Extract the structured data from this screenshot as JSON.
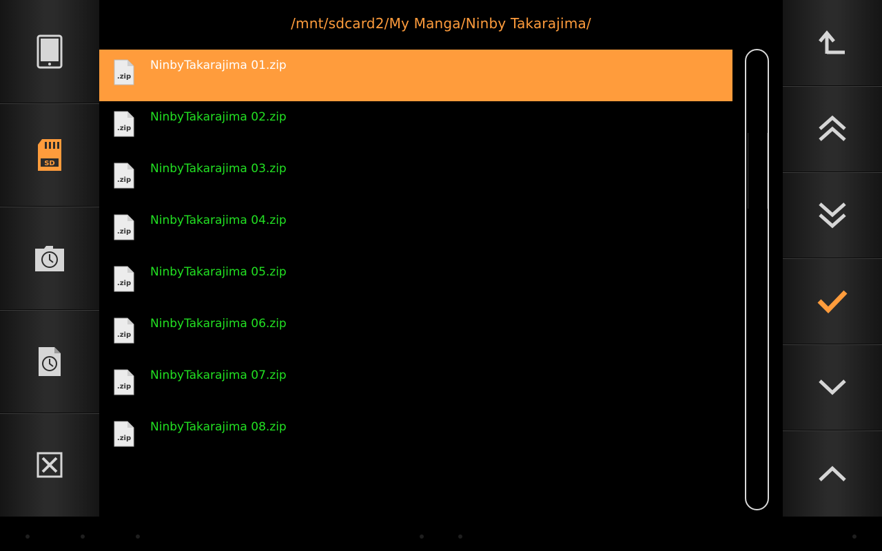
{
  "path": "/mnt/sdcard2/My Manga/Ninby Takarajima/",
  "colors": {
    "accent": "#ff9c3c",
    "file_text": "#22e022",
    "selected_text": "#ffffff",
    "icon_gray": "#d6d6d6"
  },
  "left_toolbar": [
    {
      "name": "tablet-storage-button",
      "icon": "tablet-icon"
    },
    {
      "name": "sd-card-button",
      "icon": "sd-card-icon",
      "active": true
    },
    {
      "name": "recent-folder-button",
      "icon": "folder-clock-icon"
    },
    {
      "name": "recent-file-button",
      "icon": "file-clock-icon"
    },
    {
      "name": "close-button",
      "icon": "close-box-icon"
    }
  ],
  "right_toolbar": [
    {
      "name": "parent-folder-button",
      "icon": "up-arrow-icon"
    },
    {
      "name": "page-up-button",
      "icon": "double-chevron-up-icon"
    },
    {
      "name": "page-down-button",
      "icon": "double-chevron-down-icon"
    },
    {
      "name": "confirm-button",
      "icon": "checkmark-icon",
      "active": true
    },
    {
      "name": "scroll-down-button",
      "icon": "chevron-down-icon"
    },
    {
      "name": "scroll-up-button",
      "icon": "chevron-up-icon"
    }
  ],
  "files": [
    {
      "name": "NinbyTakarajima 01.zip",
      "type": ".zip",
      "selected": true
    },
    {
      "name": "NinbyTakarajima 02.zip",
      "type": ".zip"
    },
    {
      "name": "NinbyTakarajima 03.zip",
      "type": ".zip"
    },
    {
      "name": "NinbyTakarajima 04.zip",
      "type": ".zip"
    },
    {
      "name": "NinbyTakarajima 05.zip",
      "type": ".zip"
    },
    {
      "name": "NinbyTakarajima 06.zip",
      "type": ".zip"
    },
    {
      "name": "NinbyTakarajima 07.zip",
      "type": ".zip"
    },
    {
      "name": "NinbyTakarajima 08.zip",
      "type": ".zip"
    }
  ],
  "sd_label": "SD"
}
